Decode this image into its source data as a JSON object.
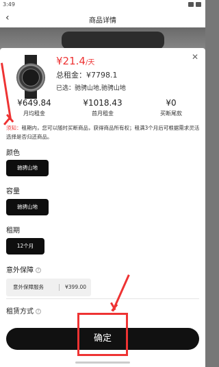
{
  "status_bar": {
    "time": "3:49"
  },
  "header": {
    "back_icon": "back-arrow-icon",
    "title": "商品详情"
  },
  "product": {
    "price": "¥21.4",
    "price_unit": "/天",
    "total_rent": "总租金：¥7798.1",
    "selected": "已选：驰骋山地,驰骋山地"
  },
  "stats": [
    {
      "value": "¥649.84",
      "label": "月均租金"
    },
    {
      "value": "¥1018.43",
      "label": "首月租金"
    },
    {
      "value": "¥0",
      "label": "买断尾款"
    }
  ],
  "notice": {
    "tag": "须知：",
    "text": "租期内，您可以随时买断商品，获得商品所有权；租满3个月后可根据需求灵活选择是否归还商品。"
  },
  "sections": {
    "color": {
      "label": "颜色",
      "option": "驰骋山地"
    },
    "capacity": {
      "label": "容量",
      "option": "驰骋山地"
    },
    "term": {
      "label": "租期",
      "option": "12个月"
    },
    "insurance": {
      "label": "意外保障",
      "name": "意外保障服务",
      "price": "¥399.00"
    },
    "method": {
      "label": "租赁方式"
    }
  },
  "confirm_label": "确定",
  "colors": {
    "accent": "#e33333",
    "button": "#111111"
  }
}
